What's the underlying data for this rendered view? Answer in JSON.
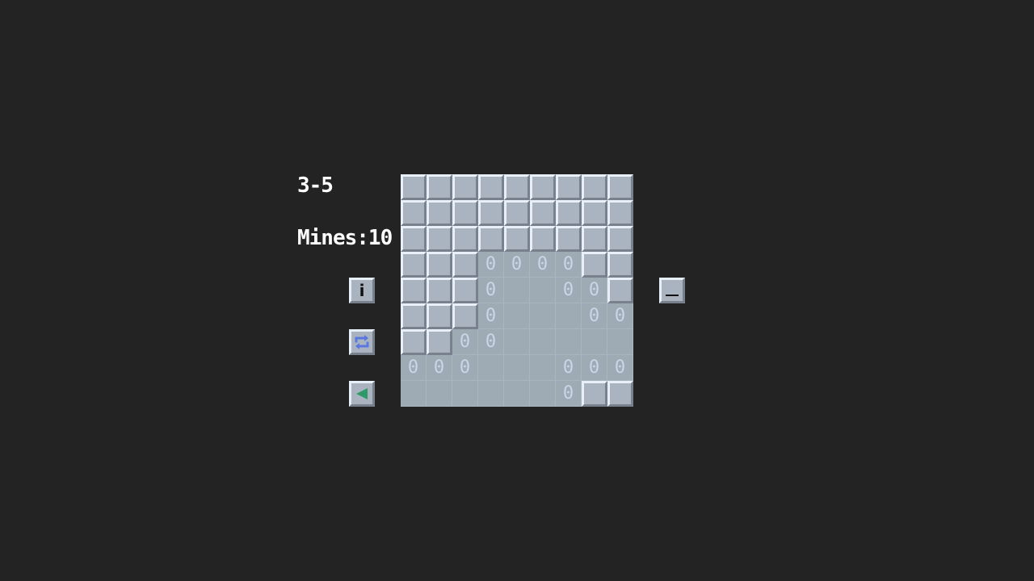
{
  "hud": {
    "level": "3-5",
    "mines": "Mines:10"
  },
  "buttons": {
    "info": {
      "icon": "info-icon",
      "glyph": "i"
    },
    "restart": {
      "icon": "restart-icon",
      "color": "#5b78e0"
    },
    "back": {
      "icon": "back-triangle-icon",
      "color": "#2e9a6a"
    },
    "minimize": {
      "icon": "minimize-icon"
    }
  },
  "board": {
    "rows": 9,
    "cols": 9,
    "legend": "C = covered tile, 0 = revealed tile showing 0, . = revealed empty tile",
    "grid": [
      [
        "C",
        "C",
        "C",
        "C",
        "C",
        "C",
        "C",
        "C",
        "C"
      ],
      [
        "C",
        "C",
        "C",
        "C",
        "C",
        "C",
        "C",
        "C",
        "C"
      ],
      [
        "C",
        "C",
        "C",
        "C",
        "C",
        "C",
        "C",
        "C",
        "C"
      ],
      [
        "C",
        "C",
        "C",
        "0",
        "0",
        "0",
        "0",
        "C",
        "C"
      ],
      [
        "C",
        "C",
        "C",
        "0",
        ".",
        ".",
        "0",
        "0",
        "C"
      ],
      [
        "C",
        "C",
        "C",
        "0",
        ".",
        ".",
        ".",
        "0",
        "0"
      ],
      [
        "C",
        "C",
        "0",
        "0",
        ".",
        ".",
        ".",
        ".",
        "."
      ],
      [
        "0",
        "0",
        "0",
        ".",
        ".",
        ".",
        "0",
        "0",
        "0"
      ],
      [
        ".",
        ".",
        ".",
        ".",
        ".",
        ".",
        "0",
        "C",
        "C"
      ]
    ]
  }
}
